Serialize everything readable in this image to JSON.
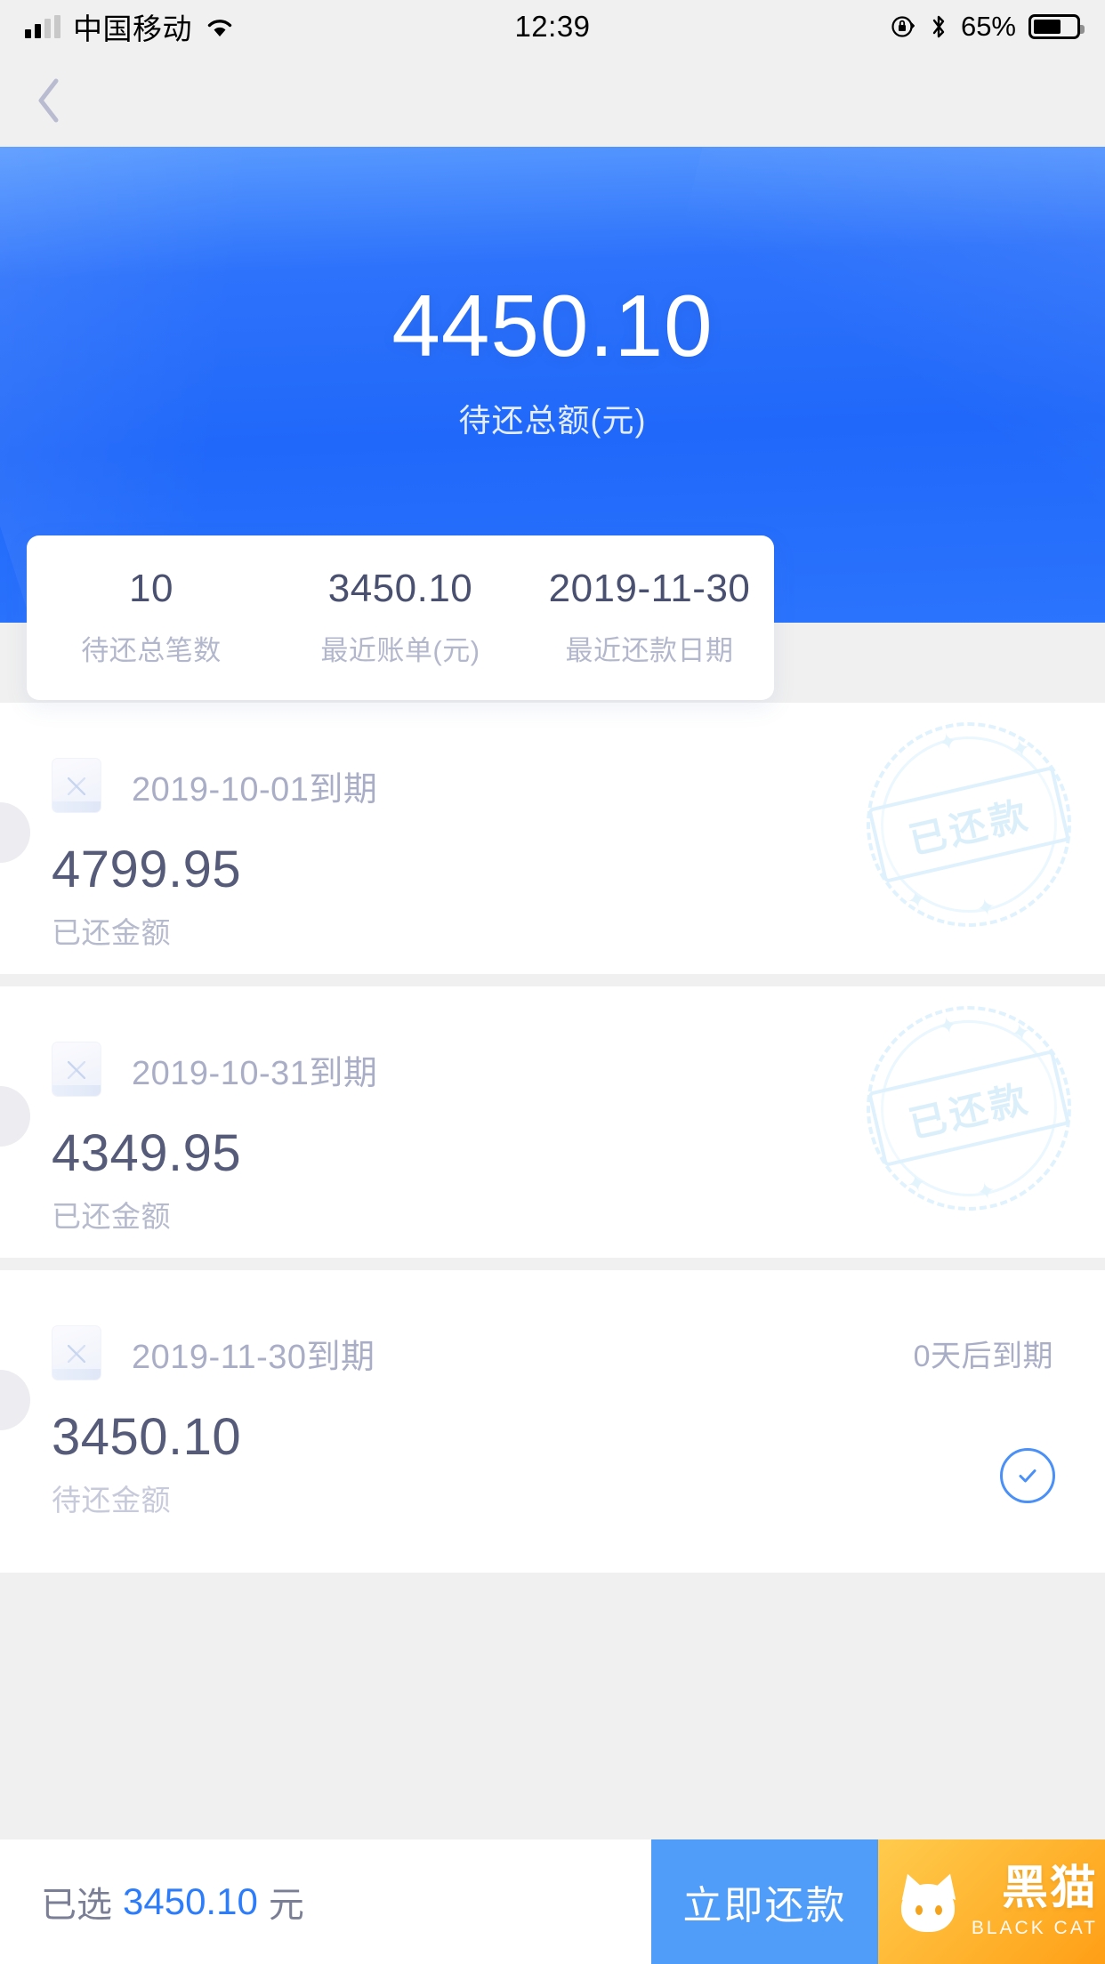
{
  "status_bar": {
    "carrier": "中国移动",
    "time": "12:39",
    "battery_percent": "65%",
    "icons": [
      "signal-icon",
      "wifi-icon",
      "rotation-lock-icon",
      "bluetooth-icon",
      "battery-icon"
    ]
  },
  "nav": {
    "back_icon": "chevron-left-icon"
  },
  "hero": {
    "amount": "4450.10",
    "label": "待还总额(元)",
    "background_color": "#2068fa"
  },
  "stats": [
    {
      "value": "10",
      "label": "待还总笔数"
    },
    {
      "value": "3450.10",
      "label": "最近账单(元)"
    },
    {
      "value": "2019-11-30",
      "label": "最近还款日期"
    }
  ],
  "bills": [
    {
      "date": "2019-10-01到期",
      "due_note": "",
      "amount": "4799.95",
      "amount_label": "已还金额",
      "stamp": "已还款",
      "selected": false
    },
    {
      "date": "2019-10-31到期",
      "due_note": "",
      "amount": "4349.95",
      "amount_label": "已还金额",
      "stamp": "已还款",
      "selected": false
    },
    {
      "date": "2019-11-30到期",
      "due_note": "0天后到期",
      "amount": "3450.10",
      "amount_label": "待还金额",
      "stamp": "",
      "selected": true
    }
  ],
  "bottom_bar": {
    "selected_prefix": "已选",
    "selected_amount": "3450.10",
    "selected_suffix": "元",
    "pay_button": "立即还款",
    "brand_cn": "黑猫",
    "brand_en": "BLACK CAT",
    "accent_color": "#2d7dfb",
    "pay_color": "#4f9cf9"
  }
}
